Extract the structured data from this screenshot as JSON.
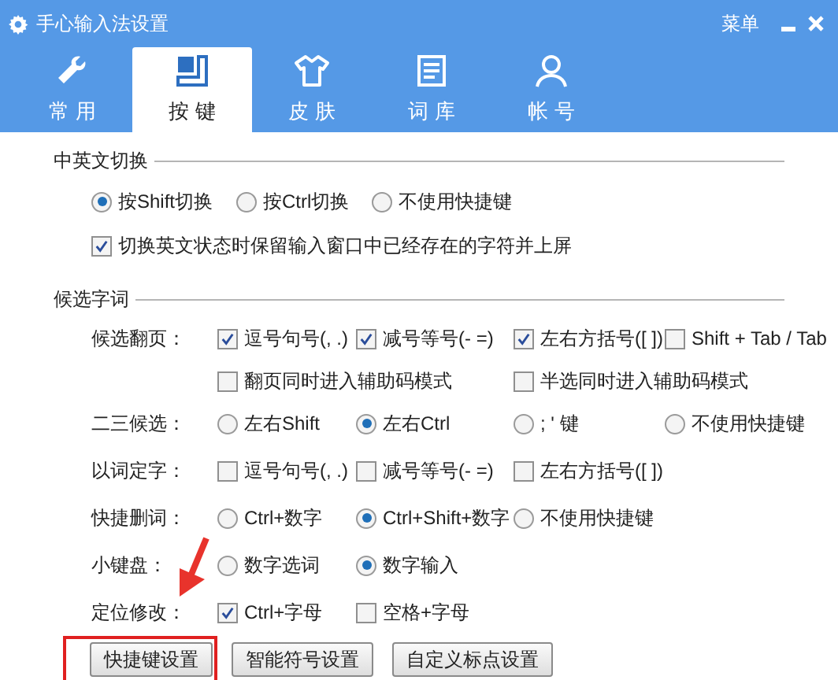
{
  "window": {
    "title": "手心输入法设置",
    "menu": "菜单"
  },
  "tabs": [
    {
      "label": "常 用",
      "selected": false
    },
    {
      "label": "按 键",
      "selected": true
    },
    {
      "label": "皮 肤",
      "selected": false
    },
    {
      "label": "词 库",
      "selected": false
    },
    {
      "label": "帐 号",
      "selected": false
    }
  ],
  "sections": [
    {
      "title": "中英文切换",
      "rows": [
        {
          "options": [
            {
              "kind": "radio",
              "text": "按Shift切换",
              "checked": true
            },
            {
              "kind": "radio",
              "text": "按Ctrl切换",
              "checked": false
            },
            {
              "kind": "radio",
              "text": "不使用快捷键",
              "checked": false
            }
          ]
        },
        {
          "options": [
            {
              "kind": "checkbox",
              "text": "切换英文状态时保留输入窗口中已经存在的字符并上屏",
              "checked": true
            }
          ]
        }
      ]
    },
    {
      "title": "候选字词",
      "rows": [
        {
          "label": "候选翻页：",
          "options": [
            {
              "kind": "checkbox",
              "text": "逗号句号(, .)",
              "checked": true
            },
            {
              "kind": "checkbox",
              "text": "减号等号(- =)",
              "checked": true
            },
            {
              "kind": "checkbox",
              "text": "左右方括号([ ])",
              "checked": true
            },
            {
              "kind": "checkbox",
              "text": "Shift + Tab / Tab",
              "checked": false
            }
          ]
        },
        {
          "options": [
            {
              "kind": "checkbox",
              "text": "翻页同时进入辅助码模式",
              "checked": false
            },
            {
              "kind": "checkbox",
              "text": "半选同时进入辅助码模式",
              "checked": false
            }
          ]
        },
        {
          "label": "二三候选：",
          "options": [
            {
              "kind": "radio",
              "text": "左右Shift",
              "checked": false
            },
            {
              "kind": "radio",
              "text": "左右Ctrl",
              "checked": true
            },
            {
              "kind": "radio",
              "text": "; ' 键",
              "checked": false
            },
            {
              "kind": "radio",
              "text": "不使用快捷键",
              "checked": false
            }
          ]
        },
        {
          "label": "以词定字：",
          "options": [
            {
              "kind": "checkbox",
              "text": "逗号句号(, .)",
              "checked": false
            },
            {
              "kind": "checkbox",
              "text": "减号等号(- =)",
              "checked": false
            },
            {
              "kind": "checkbox",
              "text": "左右方括号([ ])",
              "checked": false
            }
          ]
        },
        {
          "label": "快捷删词：",
          "options": [
            {
              "kind": "radio",
              "text": "Ctrl+数字",
              "checked": false
            },
            {
              "kind": "radio",
              "text": "Ctrl+Shift+数字",
              "checked": true
            },
            {
              "kind": "radio",
              "text": "不使用快捷键",
              "checked": false
            }
          ]
        },
        {
          "label": "小键盘：",
          "options": [
            {
              "kind": "radio",
              "text": "数字选词",
              "checked": false
            },
            {
              "kind": "radio",
              "text": "数字输入",
              "checked": true
            }
          ]
        },
        {
          "label": "定位修改：",
          "options": [
            {
              "kind": "checkbox",
              "text": "Ctrl+字母",
              "checked": true
            },
            {
              "kind": "checkbox",
              "text": "空格+字母",
              "checked": false
            }
          ]
        }
      ]
    }
  ],
  "buttons": [
    {
      "label": "快捷键设置"
    },
    {
      "label": "智能符号设置"
    },
    {
      "label": "自定义标点设置"
    }
  ]
}
